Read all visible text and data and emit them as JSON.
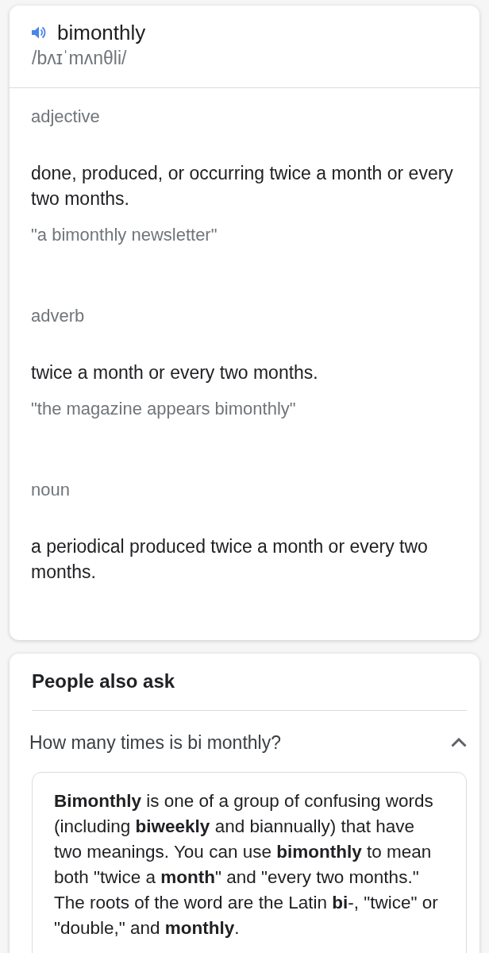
{
  "entry": {
    "word": "bimonthly",
    "phonetic": "/bʌɪˈmʌnθli/"
  },
  "senses": [
    {
      "part_of_speech": "adjective",
      "definition": "done, produced, or occurring twice a month or every two months.",
      "example": "\"a bimonthly newsletter\""
    },
    {
      "part_of_speech": "adverb",
      "definition": "twice a month or every two months.",
      "example": "\"the magazine appears bimonthly\""
    },
    {
      "part_of_speech": "noun",
      "definition": "a periodical produced twice a month or every two months."
    }
  ],
  "people_also_ask": {
    "title": "People also ask",
    "questions": [
      {
        "question": "How many times is bi monthly?",
        "expanded": true,
        "answer": "**Bimonthly** is one of a group of confusing words (including **biweekly** and biannually) that have two meanings. You can use **bimonthly** to mean both \"twice a **month**\" and \"every two months.\" The roots of the word are the Latin **bi**-, \"twice\" or \"double,\" and **monthly**."
      }
    ]
  }
}
